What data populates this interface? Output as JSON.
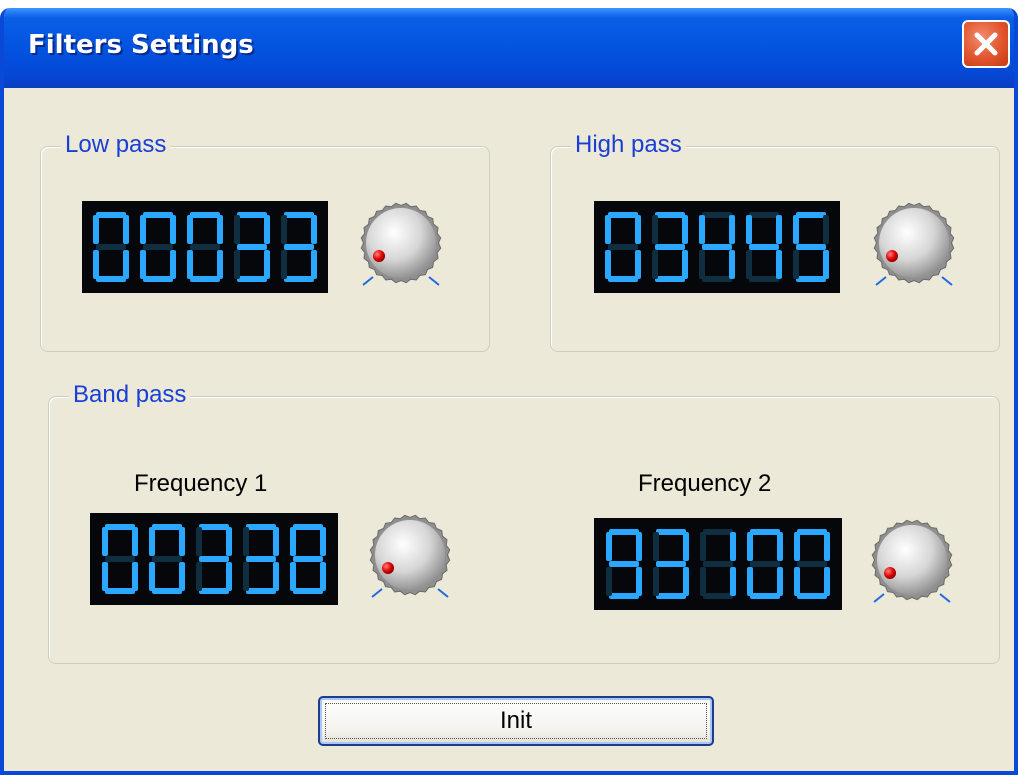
{
  "window": {
    "title": "Filters Settings",
    "close_icon": "close-icon"
  },
  "colors": {
    "lcd_on": "#2aa7ff",
    "lcd_off": "#0f2f40",
    "lcd_bg": "#05070b",
    "group_label": "#1a3fd6",
    "knob_dot": "#e00000"
  },
  "low_pass": {
    "label": "Low pass",
    "display": "00033",
    "knob_icon": "rotary-knob-icon"
  },
  "high_pass": {
    "label": "High pass",
    "display": "03445",
    "knob_icon": "rotary-knob-icon"
  },
  "band_pass": {
    "label": "Band pass",
    "frequency1": {
      "label": "Frequency 1",
      "display": "00338",
      "knob_icon": "rotary-knob-icon"
    },
    "frequency2": {
      "label": "Frequency 2",
      "display": "93100",
      "knob_icon": "rotary-knob-icon"
    }
  },
  "init_button": {
    "label": "Init"
  }
}
